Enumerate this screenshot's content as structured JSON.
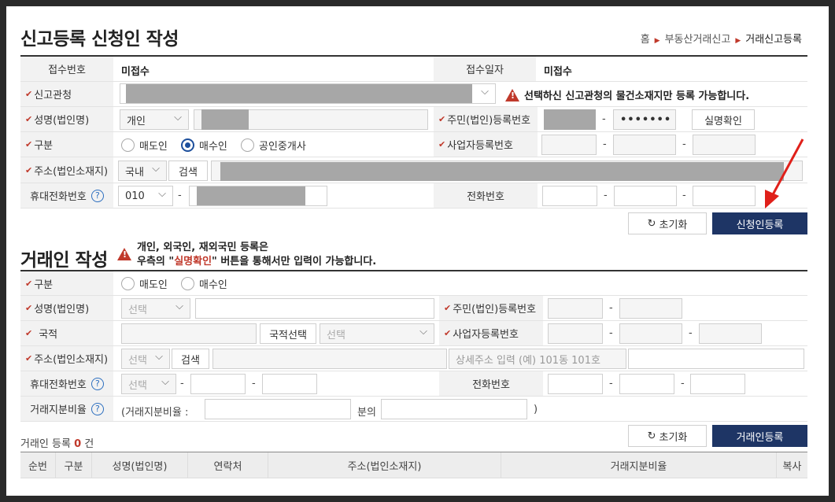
{
  "section1": {
    "title": "신고등록 신청인 작성",
    "breadcrumb": [
      "홈",
      "부동산거래신고",
      "거래신고등록"
    ],
    "receipt_no_label": "접수번호",
    "receipt_no_value": "미접수",
    "receipt_date_label": "접수일자",
    "receipt_date_value": "미접수",
    "office_label": "신고관청",
    "office_warning": "선택하신 신고관청의 물건소재지만 등록 가능합니다.",
    "name_label": "성명(법인명)",
    "name_type": "개인",
    "id_label": "주민(법인)등록번호",
    "id_masked": "•••••••",
    "verify_button": "실명확인",
    "category_label": "구분",
    "category_options": [
      "매도인",
      "매수인",
      "공인중개사"
    ],
    "category_selected": "매수인",
    "biz_label": "사업자등록번호",
    "address_label": "주소(법인소재지)",
    "address_country": "국내",
    "search_button": "검색",
    "mobile_label": "휴대전화번호",
    "mobile_prefix": "010",
    "phone_label": "전화번호",
    "reset_button": "초기화",
    "register_button": "신청인등록",
    "dash": "-"
  },
  "section2": {
    "title": "거래인 작성",
    "notice_line1": "개인, 외국인, 재외국민 등록은",
    "notice_line2_pre": "우측의 \"",
    "notice_line2_em": "실명확인",
    "notice_line2_post": "\" 버튼을 통해서만 입력이 가능합니다.",
    "category_label": "구분",
    "category_options": [
      "매도인",
      "매수인"
    ],
    "name_label": "성명(법인명)",
    "select_placeholder": "선택",
    "id_label": "주민(법인)등록번호",
    "nation_label": "국적",
    "nation_button": "국적선택",
    "biz_label": "사업자등록번호",
    "address_label": "주소(법인소재지)",
    "search_button": "검색",
    "address_detail_placeholder": "상세주소 입력 (예) 101동 101호",
    "mobile_label": "휴대전화번호",
    "phone_label": "전화번호",
    "share_label": "거래지분비율",
    "share_prefix": "(거래지분비율 :",
    "share_mid": "분의",
    "share_suffix": ")",
    "count_prefix": "거래인 등록",
    "count_value": "0",
    "count_suffix": "건",
    "reset_button": "초기화",
    "register_button": "거래인등록",
    "dash": "-"
  },
  "table": {
    "columns": [
      "순번",
      "구분",
      "성명(법인명)",
      "연락처",
      "주소(법인소재지)",
      "거래지분비율",
      "복사"
    ]
  },
  "colors": {
    "accent": "#1e3565",
    "required": "#c0392b",
    "annotation_arrow": "#e0201a"
  }
}
